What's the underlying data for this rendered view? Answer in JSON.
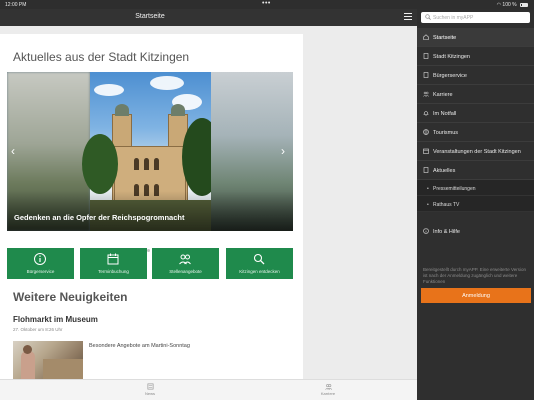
{
  "status_bar": {
    "time": "12:00 PM",
    "dots": "•••",
    "battery": "100 %"
  },
  "nav_bar": {
    "title": "Startseite"
  },
  "main": {
    "section_title": "Aktuelles aus der Stadt Kitzingen",
    "slide_caption": "Gedenken an die Opfer der Reichspogromnacht",
    "tiles": [
      {
        "label": "Bürgerservice",
        "icon": "info-icon"
      },
      {
        "label": "Terminbuchung",
        "icon": "calendar-icon"
      },
      {
        "label": "Stellenangebote",
        "icon": "people-icon"
      },
      {
        "label": "Kitzingen entdecken",
        "icon": "search-icon"
      }
    ],
    "more_title": "Weitere Neuigkeiten",
    "news": {
      "title": "Flohmarkt im Museum",
      "date": "27. Oktober um 8:26 Uhr",
      "text": "Besondere Angebote am Martini-Sonntag"
    }
  },
  "tab_bar": {
    "tabs": [
      {
        "label": "News",
        "icon": "news-icon"
      },
      {
        "label": "Karriere",
        "icon": "people-icon"
      }
    ]
  },
  "sidebar": {
    "search_placeholder": "Suchen in myAPP",
    "items": [
      {
        "label": "Startseite",
        "icon": "home-icon"
      },
      {
        "label": "Stadt Kitzingen",
        "icon": "document-icon"
      },
      {
        "label": "Bürgerservice",
        "icon": "document-icon"
      },
      {
        "label": "Karriere",
        "icon": "people-icon"
      },
      {
        "label": "Im Notfall",
        "icon": "bell-icon"
      },
      {
        "label": "Tourismus",
        "icon": "globe-icon"
      },
      {
        "label": "Veranstaltungen der Stadt Kitzingen",
        "icon": "calendar-icon"
      },
      {
        "label": "Aktuelles",
        "icon": "document-icon"
      }
    ],
    "subitems": [
      {
        "label": "Pressemitteilungen"
      },
      {
        "label": "Rathaus TV"
      }
    ],
    "info_item": {
      "label": "Info & Hilfe",
      "icon": "info-icon"
    },
    "login_note": "Bereitgestellt durch myAPP. Eine erweiterte Version ist nach der Anmeldung zugänglich und weitere Funktionen",
    "login_button": "Anmeldung"
  },
  "colors": {
    "accent_green": "#1f8a4c",
    "accent_orange": "#e8731a",
    "sidebar_bg": "#2f2f2f",
    "navbar_bg": "#333333"
  }
}
